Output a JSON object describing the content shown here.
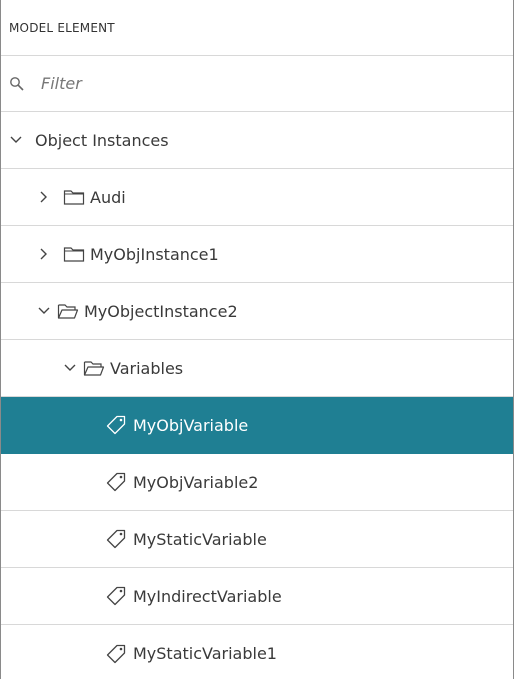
{
  "header": {
    "title": "MODEL ELEMENT"
  },
  "filter": {
    "placeholder": "Filter"
  },
  "tree": {
    "root": {
      "label": "Object Instances",
      "expanded": true
    },
    "audi": {
      "label": "Audi",
      "expanded": false
    },
    "instance1": {
      "label": "MyObjInstance1",
      "expanded": false
    },
    "instance2": {
      "label": "MyObjectInstance2",
      "expanded": true
    },
    "variables": {
      "label": "Variables",
      "expanded": true
    },
    "items": [
      {
        "label": "MyObjVariable",
        "selected": true
      },
      {
        "label": "MyObjVariable2",
        "selected": false
      },
      {
        "label": "MyStaticVariable",
        "selected": false
      },
      {
        "label": "MyIndirectVariable",
        "selected": false
      },
      {
        "label": "MyStaticVariable1",
        "selected": false
      }
    ]
  },
  "colors": {
    "selected_bg": "#1f7f93",
    "selected_text": "#ffffff",
    "divider": "#d8d8d8"
  },
  "icons": {
    "search": "search-icon",
    "chevron_right": "chevron-right-icon",
    "chevron_down": "chevron-down-icon",
    "folder": "folder-icon",
    "folder_open": "folder-open-icon",
    "tag": "tag-icon"
  }
}
